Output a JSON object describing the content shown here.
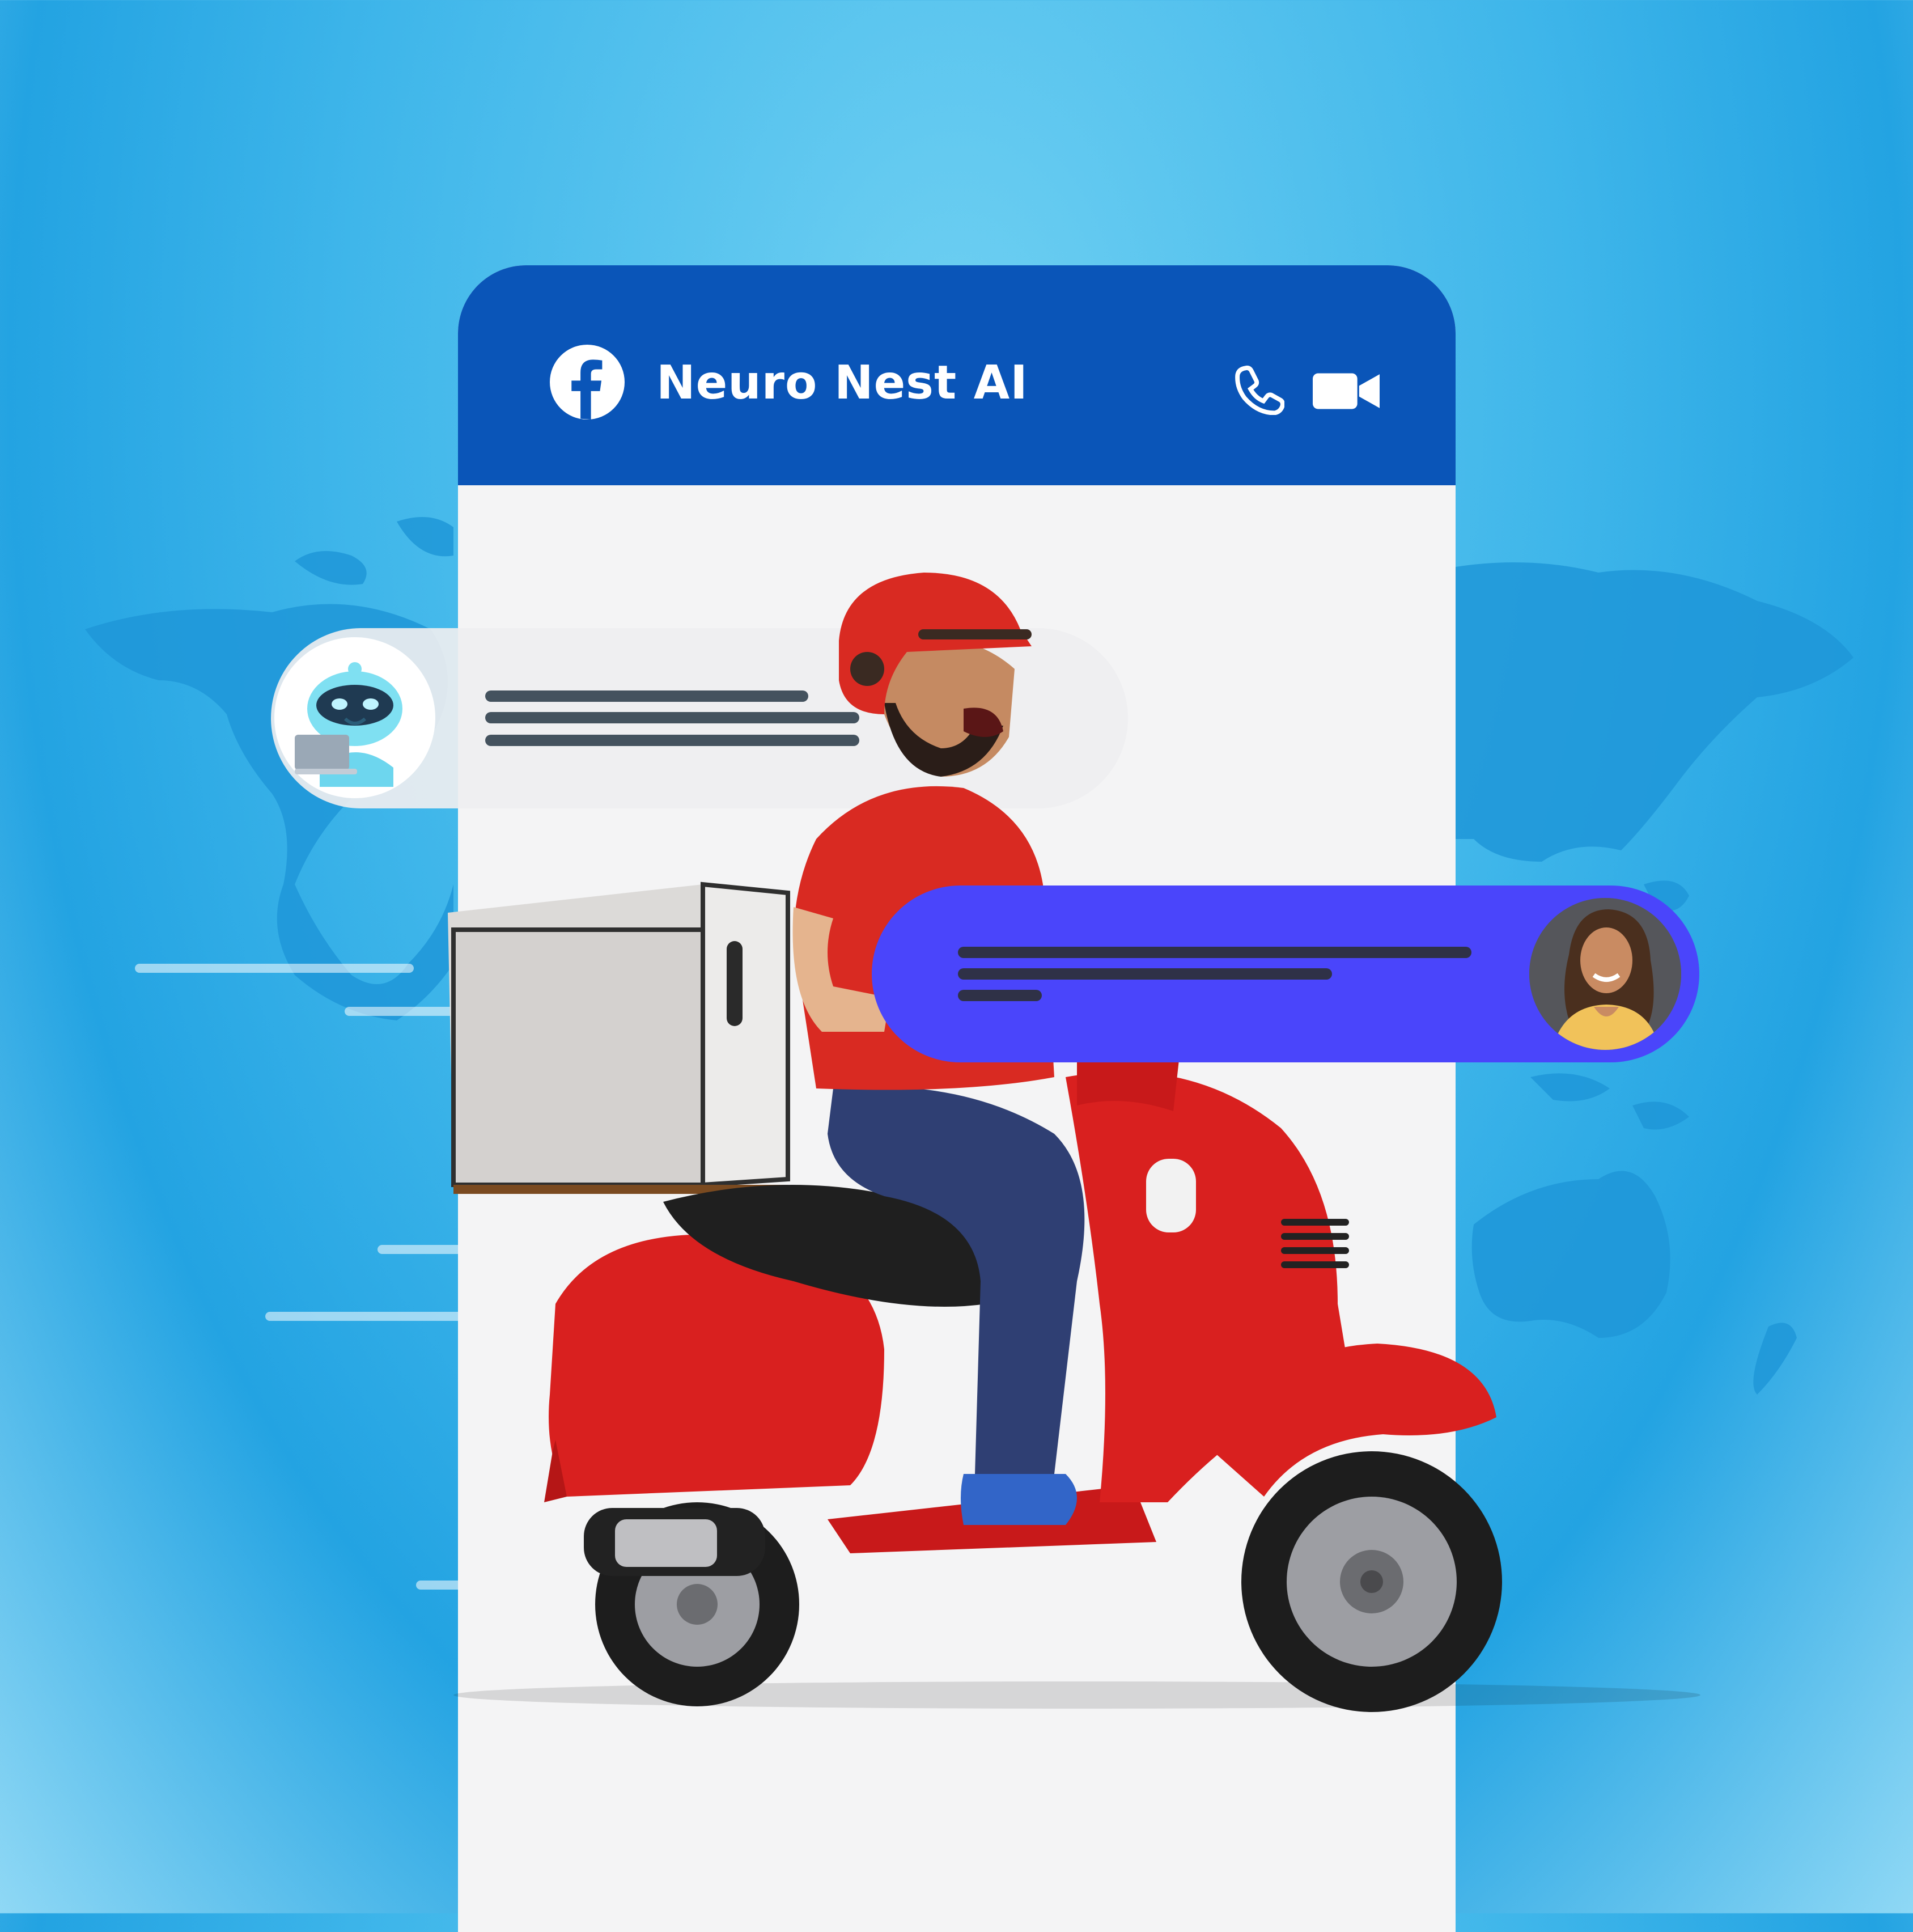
{
  "header": {
    "title": "Neuro Nest AI",
    "logo_icon": "facebook-icon",
    "call_icon": "phone-icon",
    "video_icon": "video-camera-icon"
  },
  "messages": [
    {
      "sender": "bot",
      "avatar": "robot-avatar"
    },
    {
      "sender": "user",
      "avatar": "woman-avatar"
    }
  ],
  "colors": {
    "header": "#0a55b8",
    "user_bubble": "#4a45fb",
    "scooter": "#d9201f"
  }
}
